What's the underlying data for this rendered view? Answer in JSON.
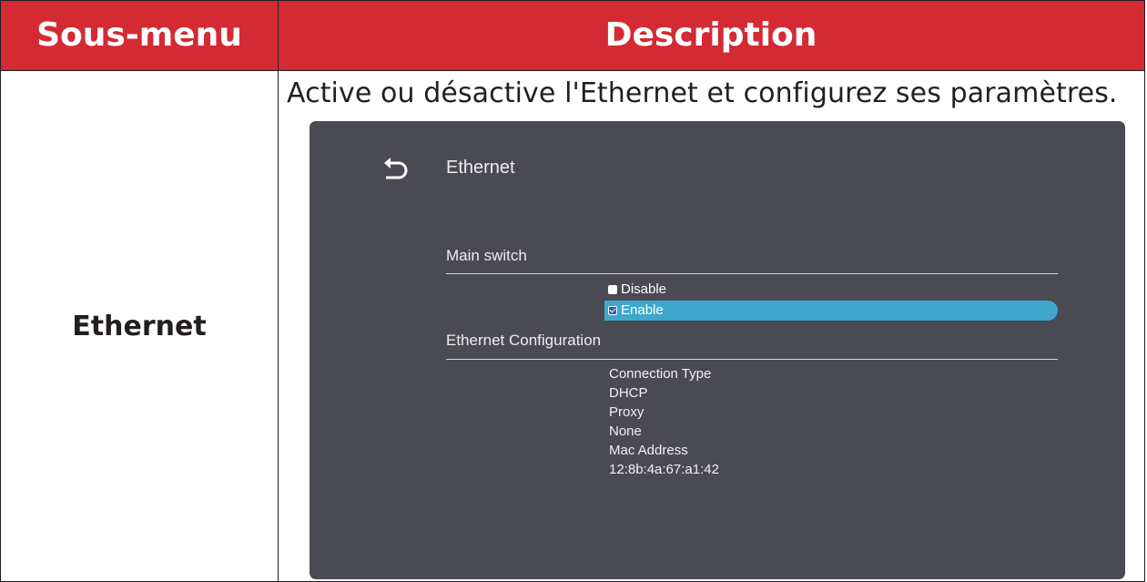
{
  "table": {
    "header": {
      "col1": "Sous-menu",
      "col2": "Description"
    },
    "row": {
      "submenu": "Ethernet",
      "description": "Active ou désactive l'Ethernet et configurez ses paramètres."
    }
  },
  "screen": {
    "title": "Ethernet",
    "main_switch_label": "Main switch",
    "options": [
      {
        "label": "Disable",
        "checked": false,
        "selected": false
      },
      {
        "label": "Enable",
        "checked": true,
        "selected": true
      }
    ],
    "config_label": "Ethernet Configuration",
    "info_lines": [
      "Connection Type",
      "DHCP",
      "Proxy",
      "None",
      "Mac Address",
      "12:8b:4a:67:a1:42"
    ],
    "icons": {
      "back": "back-arrow-icon"
    },
    "colors": {
      "header": "#d42a33",
      "panel": "#494a52",
      "selected": "#3fa7cd"
    }
  }
}
